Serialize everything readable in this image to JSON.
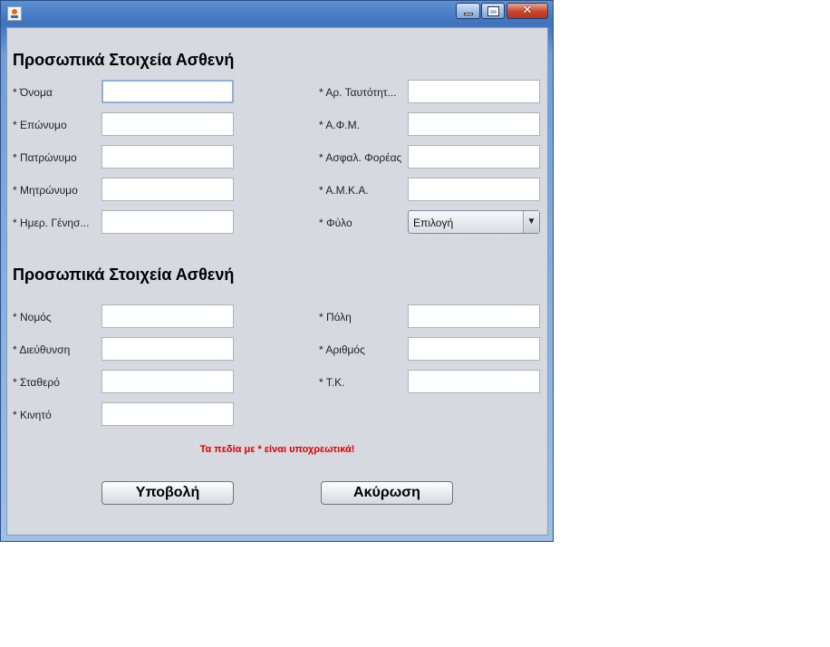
{
  "window": {
    "controls": {
      "minimize": "minimize",
      "maximize": "maximize",
      "close": "✕"
    }
  },
  "section1": {
    "title": "Προσωπικά Στοιχεία Ασθενή",
    "left_labels": [
      "* Όνομα",
      "* Επώνυμο",
      "* Πατρώνυμο",
      "* Μητρώνυμο",
      "* Ημερ. Γένησ..."
    ],
    "right_labels": [
      "* Αρ. Ταυτότητ...",
      "* Α.Φ.Μ.",
      "* Ασφαλ. Φορέας",
      "* Α.Μ.Κ.Α.",
      "* Φύλο"
    ],
    "gender_select": {
      "value": "Επιλογή",
      "arrow": "▼"
    }
  },
  "section2": {
    "title": "Προσωπικά Στοιχεία Ασθενή",
    "left_labels": [
      "* Νομός",
      "* Διεύθυνση",
      "* Σταθερό",
      "* Κινητό"
    ],
    "right_labels": [
      "* Πόλη",
      "* Αριθμός",
      "* Τ.Κ."
    ]
  },
  "note": "Τα πεδία με * είναι υποχρεωτικά!",
  "buttons": {
    "submit": "Υποβολή",
    "cancel": "Ακύρωση"
  },
  "colors": {
    "note_red": "#e00000",
    "window_blue": "#3f72bd",
    "panel_bg": "#d6d9e0"
  }
}
